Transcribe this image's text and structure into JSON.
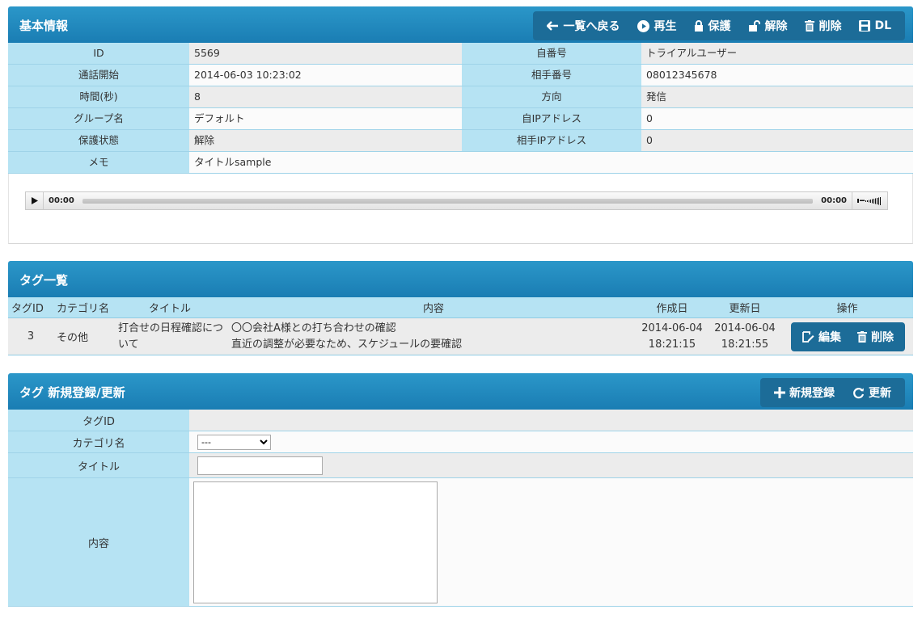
{
  "info_panel": {
    "title": "基本情報",
    "buttons": {
      "back": "一覧へ戻る",
      "play": "再生",
      "protect": "保護",
      "release": "解除",
      "delete": "削除",
      "download": "DL"
    },
    "rows": [
      {
        "label1": "ID",
        "value1": "5569",
        "label2": "自番号",
        "value2": "トライアルユーザー"
      },
      {
        "label1": "通話開始",
        "value1": "2014-06-03 10:23:02",
        "label2": "相手番号",
        "value2": "08012345678"
      },
      {
        "label1": "時間(秒)",
        "value1": "8",
        "label2": "方向",
        "value2": "発信"
      },
      {
        "label1": "グループ名",
        "value1": "デフォルト",
        "label2": "自IPアドレス",
        "value2": "0"
      },
      {
        "label1": "保護状態",
        "value1": "解除",
        "label2": "相手IPアドレス",
        "value2": "0"
      }
    ],
    "memo_label": "メモ",
    "memo_value": "タイトルsample",
    "audio": {
      "current_time": "00:00",
      "duration": "00:00",
      "progress": 0
    }
  },
  "tag_list": {
    "title": "タグ一覧",
    "headers": {
      "id": "タグID",
      "category": "カテゴリ名",
      "title": "タイトル",
      "content": "内容",
      "created": "作成日",
      "updated": "更新日",
      "ops": "操作"
    },
    "rows": [
      {
        "id": "3",
        "category": "その他",
        "title_line1": "打合せの日程確認につ",
        "title_line2": "いて",
        "content_line1": "〇〇会社A様との打ち合わせの確認",
        "content_line2": "直近の調整が必要なため、スケジュールの要確認",
        "created_date": "2014-06-04",
        "created_time": "18:21:15",
        "updated_date": "2014-06-04",
        "updated_time": "18:21:55",
        "edit_label": "編集",
        "delete_label": "削除"
      }
    ]
  },
  "tag_form": {
    "title": "タグ 新規登録/更新",
    "buttons": {
      "new": "新規登録",
      "update": "更新"
    },
    "fields": {
      "tag_id_label": "タグID",
      "category_label": "カテゴリ名",
      "category_selected": "---",
      "title_label": "タイトル",
      "content_label": "内容"
    }
  }
}
